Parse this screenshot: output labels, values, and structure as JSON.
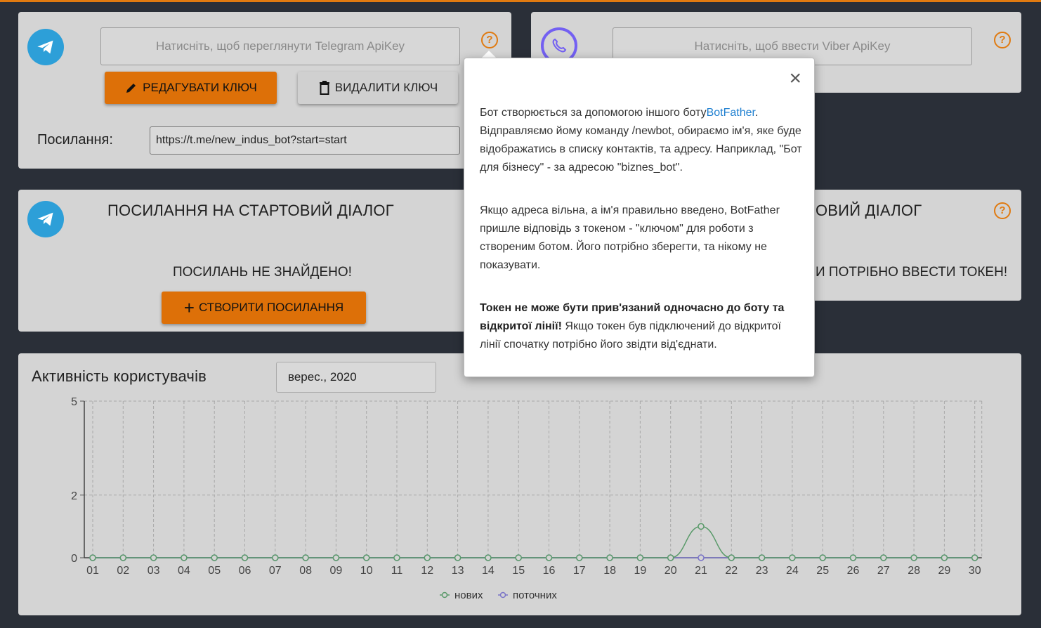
{
  "telegram_key_card": {
    "key_placeholder": "Натисніть, щоб переглянути Telegram ApiKey",
    "edit_button": "РЕДАГУВАТИ КЛЮЧ",
    "delete_button": "ВИДАЛИТИ КЛЮЧ",
    "link_label": "Посилання:",
    "link_value": "https://t.me/new_indus_bot?start=start"
  },
  "viber_key_card": {
    "key_placeholder": "Натисніть, щоб ввести Viber ApiKey"
  },
  "telegram_dialog_card": {
    "title": "ПОСИЛАННЯ НА СТАРТОВИЙ ДІАЛОГ",
    "empty_text": "ПОСИЛАНЬ НЕ ЗНАЙДЕНО!",
    "create_button": "СТВОРИТИ ПОСИЛАННЯ"
  },
  "viber_dialog_card": {
    "title_partial": "ОВИЙ ДІАЛОГ",
    "message_partial": "И ПОТРІБНО ВВЕСТИ ТОКЕН!"
  },
  "popover": {
    "close_glyph": "×",
    "p1_before_link": "Бот створюється за допомогою іншого боту",
    "p1_link": "BotFather",
    "p1_after_link": ". Відправляємо йому команду /newbot, обираємо ім'я, яке буде відображатись в списку контактів, та адресу. Наприклад, \"Бот для бізнесу\" - за адресою \"biznes_bot\".",
    "p2": "Якщо адреса вільна, а ім'я правильно введено, BotFather пришле відповідь з токеном - \"ключом\" для роботи з створеним ботом. Його потрібно зберегти, та нікому не показувати.",
    "p3_bold": "Токен не може бути прив'язаний одночасно до боту та відкритої лінії!",
    "p3_rest": " Якщо токен був підключений до відкритої лінії спочатку потрібно його звідти від'єднати."
  },
  "activity": {
    "title": "Активність користувачів",
    "month": "верес., 2020"
  },
  "chart_data": {
    "type": "line",
    "categories": [
      "01",
      "02",
      "03",
      "04",
      "05",
      "06",
      "07",
      "08",
      "09",
      "10",
      "11",
      "12",
      "13",
      "14",
      "15",
      "16",
      "17",
      "18",
      "19",
      "20",
      "21",
      "22",
      "23",
      "24",
      "25",
      "26",
      "27",
      "28",
      "29",
      "30"
    ],
    "series": [
      {
        "name": "нових",
        "color": "#5a9a6a",
        "values": [
          0,
          0,
          0,
          0,
          0,
          0,
          0,
          0,
          0,
          0,
          0,
          0,
          0,
          0,
          0,
          0,
          0,
          0,
          0,
          0,
          1,
          0,
          0,
          0,
          0,
          0,
          0,
          0,
          0,
          0
        ]
      },
      {
        "name": "поточних",
        "color": "#7a74c8",
        "values": [
          0,
          0,
          0,
          0,
          0,
          0,
          0,
          0,
          0,
          0,
          0,
          0,
          0,
          0,
          0,
          0,
          0,
          0,
          0,
          0,
          0,
          0,
          0,
          0,
          0,
          0,
          0,
          0,
          0,
          0
        ]
      }
    ],
    "yticks": [
      0,
      2,
      5
    ],
    "ylim": [
      0,
      5
    ],
    "grid": true,
    "legend": "bottom-center"
  }
}
